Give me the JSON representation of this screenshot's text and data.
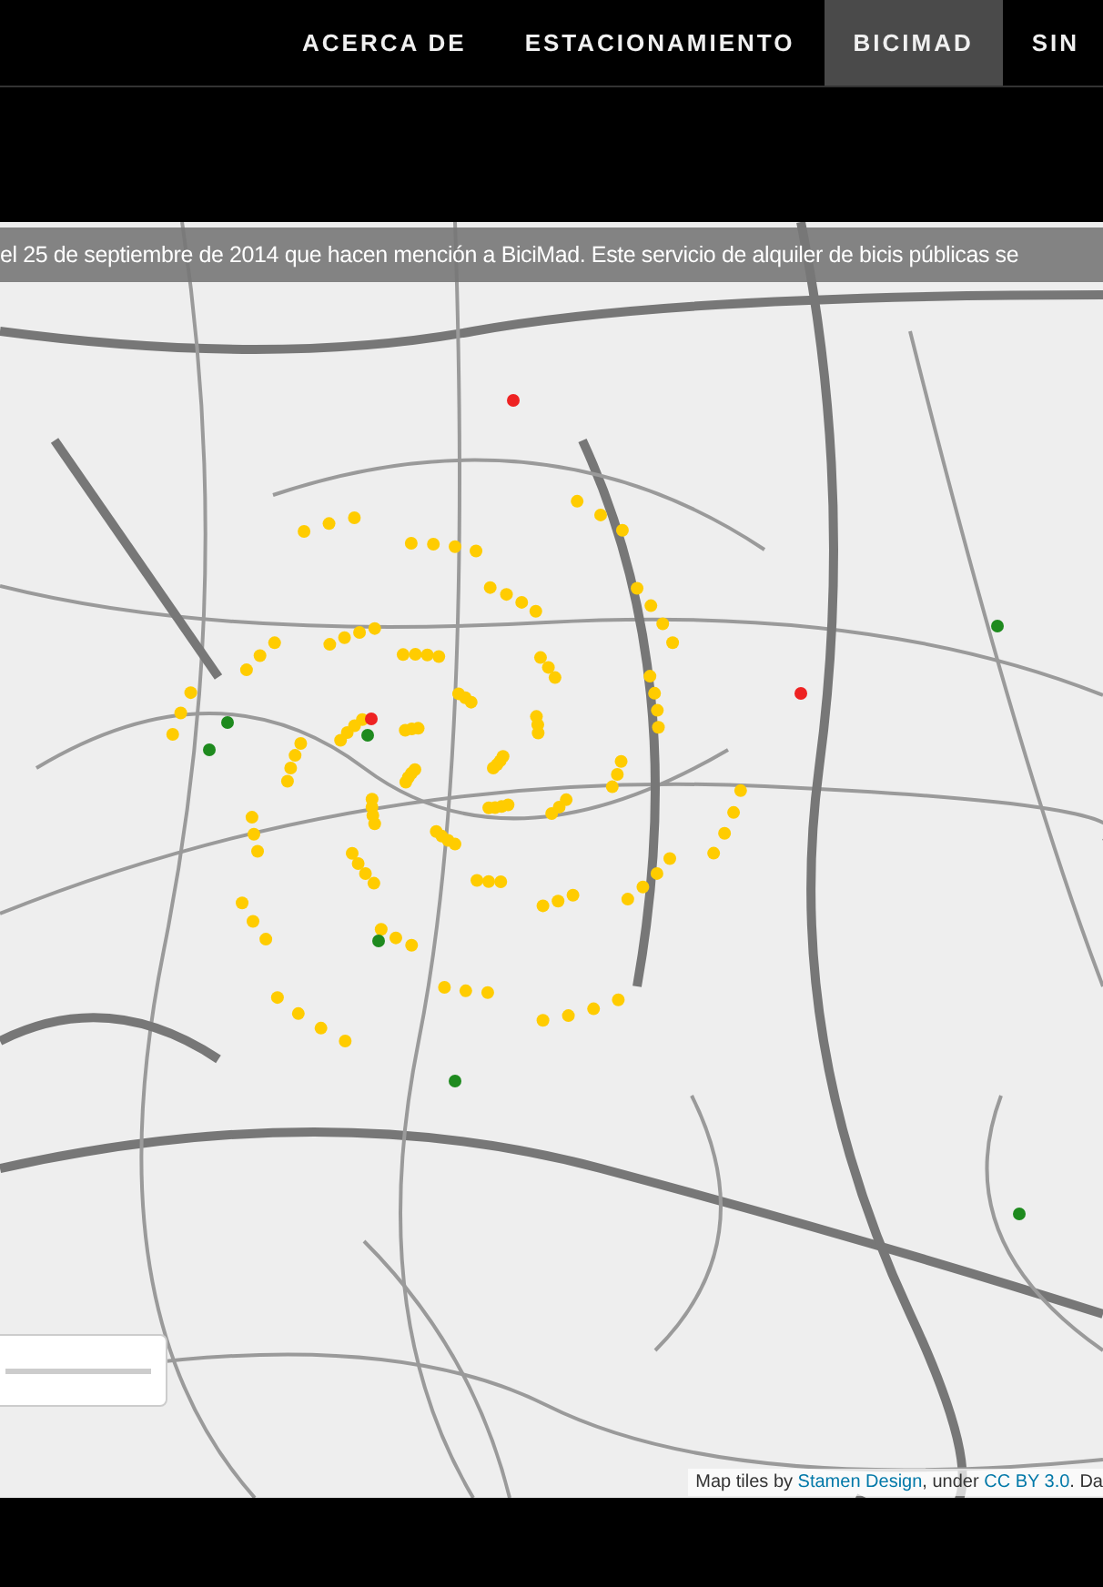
{
  "nav": {
    "items": [
      {
        "label": "ACERCA DE",
        "selected": false
      },
      {
        "label": "ESTACIONAMIENTO",
        "selected": false
      },
      {
        "label": "BICIMAD",
        "selected": true
      },
      {
        "label": "SIN",
        "selected": false
      }
    ]
  },
  "map": {
    "banner": "el 25 de septiembre de 2014 que hacen mención a BiciMad. Este servicio de alquiler de bicis públicas se",
    "attribution": {
      "prefix": "Map tiles by ",
      "link_1": "Stamen Design",
      "middle": ", under ",
      "link_2": "CC BY 3.0",
      "suffix": ". Da"
    }
  }
}
